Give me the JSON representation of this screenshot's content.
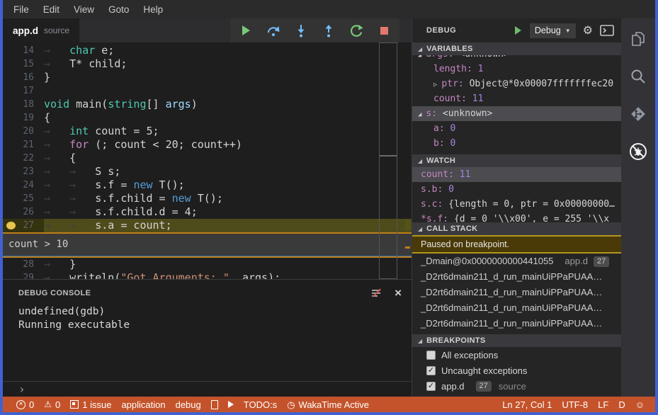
{
  "menu": {
    "items": [
      "File",
      "Edit",
      "View",
      "Goto",
      "Help"
    ]
  },
  "tab": {
    "title": "app.d",
    "detail": "source"
  },
  "toolbar": {
    "buttons": [
      "continue",
      "step-over",
      "step-into",
      "step-out",
      "restart",
      "stop"
    ]
  },
  "editor": {
    "condition_widget": "count > 10",
    "breakpoint_line": 27,
    "lines": [
      {
        "n": 14,
        "segs": [
          [
            "w",
            "→   "
          ],
          [
            "t",
            "char"
          ],
          [
            "p",
            " e;"
          ]
        ]
      },
      {
        "n": 15,
        "segs": [
          [
            "w",
            "→   "
          ],
          [
            "p",
            "T* child;"
          ]
        ]
      },
      {
        "n": 16,
        "segs": [
          [
            "p",
            "}"
          ]
        ]
      },
      {
        "n": 17,
        "segs": []
      },
      {
        "n": 18,
        "segs": [
          [
            "t",
            "void"
          ],
          [
            "p",
            " main("
          ],
          [
            "t",
            "string"
          ],
          [
            "p",
            "[] "
          ],
          [
            "a",
            "args"
          ],
          [
            "p",
            ")"
          ]
        ]
      },
      {
        "n": 19,
        "segs": [
          [
            "p",
            "{"
          ]
        ]
      },
      {
        "n": 20,
        "segs": [
          [
            "w",
            "→   "
          ],
          [
            "t",
            "int"
          ],
          [
            "p",
            " count = 5;"
          ]
        ]
      },
      {
        "n": 21,
        "segs": [
          [
            "w",
            "→   "
          ],
          [
            "k",
            "for"
          ],
          [
            "p",
            " (; count < 20; count++)"
          ]
        ]
      },
      {
        "n": 22,
        "segs": [
          [
            "w",
            "→   "
          ],
          [
            "p",
            "{"
          ]
        ]
      },
      {
        "n": 23,
        "segs": [
          [
            "w",
            "→   "
          ],
          [
            "w",
            "→   "
          ],
          [
            "p",
            "S s;"
          ]
        ]
      },
      {
        "n": 24,
        "segs": [
          [
            "w",
            "→   "
          ],
          [
            "w",
            "→   "
          ],
          [
            "p",
            "s.f = "
          ],
          [
            "n",
            "new"
          ],
          [
            "p",
            " T();"
          ]
        ]
      },
      {
        "n": 25,
        "segs": [
          [
            "w",
            "→   "
          ],
          [
            "w",
            "→   "
          ],
          [
            "p",
            "s.f.child = "
          ],
          [
            "n",
            "new"
          ],
          [
            "p",
            " T();"
          ]
        ]
      },
      {
        "n": 26,
        "segs": [
          [
            "w",
            "→   "
          ],
          [
            "w",
            "→   "
          ],
          [
            "p",
            "s.f.child.d = 4;"
          ]
        ]
      },
      {
        "n": 27,
        "bp": true,
        "hl": true,
        "segs": [
          [
            "w",
            "→   "
          ],
          [
            "w",
            "→   "
          ],
          [
            "p",
            "s.a = count;"
          ]
        ]
      },
      {
        "n": 28,
        "segs": [
          [
            "w",
            "→   "
          ],
          [
            "p",
            "}"
          ]
        ]
      },
      {
        "n": 29,
        "segs": [
          [
            "w",
            "→   "
          ],
          [
            "p",
            "writeln("
          ],
          [
            "s",
            "\"Got Arguments: \""
          ],
          [
            "p",
            ", args);"
          ]
        ]
      }
    ]
  },
  "console": {
    "title": "DEBUG CONSOLE",
    "lines": [
      "undefined(gdb)",
      "Running executable"
    ],
    "prompt": "›"
  },
  "panel": {
    "title": "DEBUG",
    "config_label": "Debug",
    "sections": {
      "variables": {
        "title": "VARIABLES",
        "rows": [
          {
            "tw": "open",
            "name": "args",
            "value": "<unknown>",
            "vk": "text",
            "depth": 0,
            "clip": true
          },
          {
            "name": "length",
            "value": "1",
            "vk": "num",
            "depth": 1
          },
          {
            "tw": "closed",
            "name": "ptr",
            "value": "Object@*0x00007fffffffec20",
            "vk": "text",
            "depth": 1
          },
          {
            "name": "count",
            "value": "11",
            "vk": "num",
            "depth": 1
          },
          {
            "tw": "open",
            "name": "s",
            "value": "<unknown>",
            "vk": "text",
            "depth": 0,
            "sel": true
          },
          {
            "name": "a",
            "value": "0",
            "vk": "num",
            "depth": 1
          },
          {
            "name": "b",
            "value": "0",
            "vk": "num",
            "depth": 1
          }
        ]
      },
      "watch": {
        "title": "WATCH",
        "rows": [
          {
            "name": "count",
            "value": "11",
            "vk": "num",
            "sel": true
          },
          {
            "name": "s.b",
            "value": "0",
            "vk": "num"
          },
          {
            "name": "s.c",
            "value": "{length = 0, ptr = 0x00000000…",
            "vk": "text"
          },
          {
            "name": "*s.f",
            "value": "{d = 0 '\\\\x00', e = 255 '\\\\x",
            "vk": "text"
          }
        ]
      },
      "call_stack": {
        "title": "CALL STACK",
        "status": "Paused on breakpoint.",
        "frames": [
          {
            "name": "_Dmain@0x0000000000441055",
            "file": "app.d",
            "line": "27"
          },
          {
            "name": "_D2rt6dmain211_d_run_mainUiPPaPUAA…"
          },
          {
            "name": "_D2rt6dmain211_d_run_mainUiPPaPUAA…"
          },
          {
            "name": "_D2rt6dmain211_d_run_mainUiPPaPUAA…"
          },
          {
            "name": "_D2rt6dmain211_d_run_mainUiPPaPUAA…"
          }
        ]
      },
      "breakpoints": {
        "title": "BREAKPOINTS",
        "rows": [
          {
            "checked": false,
            "label": "All exceptions"
          },
          {
            "checked": true,
            "label": "Uncaught exceptions"
          },
          {
            "checked": true,
            "label": "app.d",
            "line": "27",
            "detail": "source"
          }
        ]
      }
    }
  },
  "activity_bar": {
    "items": [
      {
        "name": "explorer"
      },
      {
        "name": "search"
      },
      {
        "name": "source-control"
      },
      {
        "name": "debug",
        "active": true
      }
    ]
  },
  "status_bar": {
    "left": [
      {
        "icon": "error",
        "text": "0"
      },
      {
        "icon": "warning",
        "text": "0"
      },
      {
        "icon": "issues",
        "text": "1 issue"
      },
      {
        "text": "application"
      },
      {
        "text": "debug"
      },
      {
        "icon": "file"
      },
      {
        "icon": "run"
      },
      {
        "text": "TODO:s"
      },
      {
        "icon": "clock",
        "text": "WakaTime Active"
      }
    ],
    "right": [
      {
        "text": "Ln 27, Col 1"
      },
      {
        "text": "UTF-8"
      },
      {
        "text": "LF"
      },
      {
        "text": "D"
      },
      {
        "icon": "smiley"
      }
    ]
  },
  "glyphs": {
    "gear": "⚙",
    "caret": "▼",
    "close": "×",
    "clock": "◷",
    "smiley": "☺",
    "warning": "⚠",
    "twistie_open": "◢",
    "twistie_closed": "▷",
    "section_twistie": "◢",
    "check": "✓"
  },
  "colors": {
    "window_border": "#4161cf",
    "status_bar": "#c4532b",
    "breakpoint": "#e8c44c",
    "line_highlight": "#4f4c1c",
    "condition_border": "#bf7e17",
    "paused_banner_border": "#b3961e",
    "keyword_pink": "#c586c0",
    "type_teal": "#4ec9b0",
    "new_blue": "#569cd6",
    "string_orange": "#ce9178"
  }
}
